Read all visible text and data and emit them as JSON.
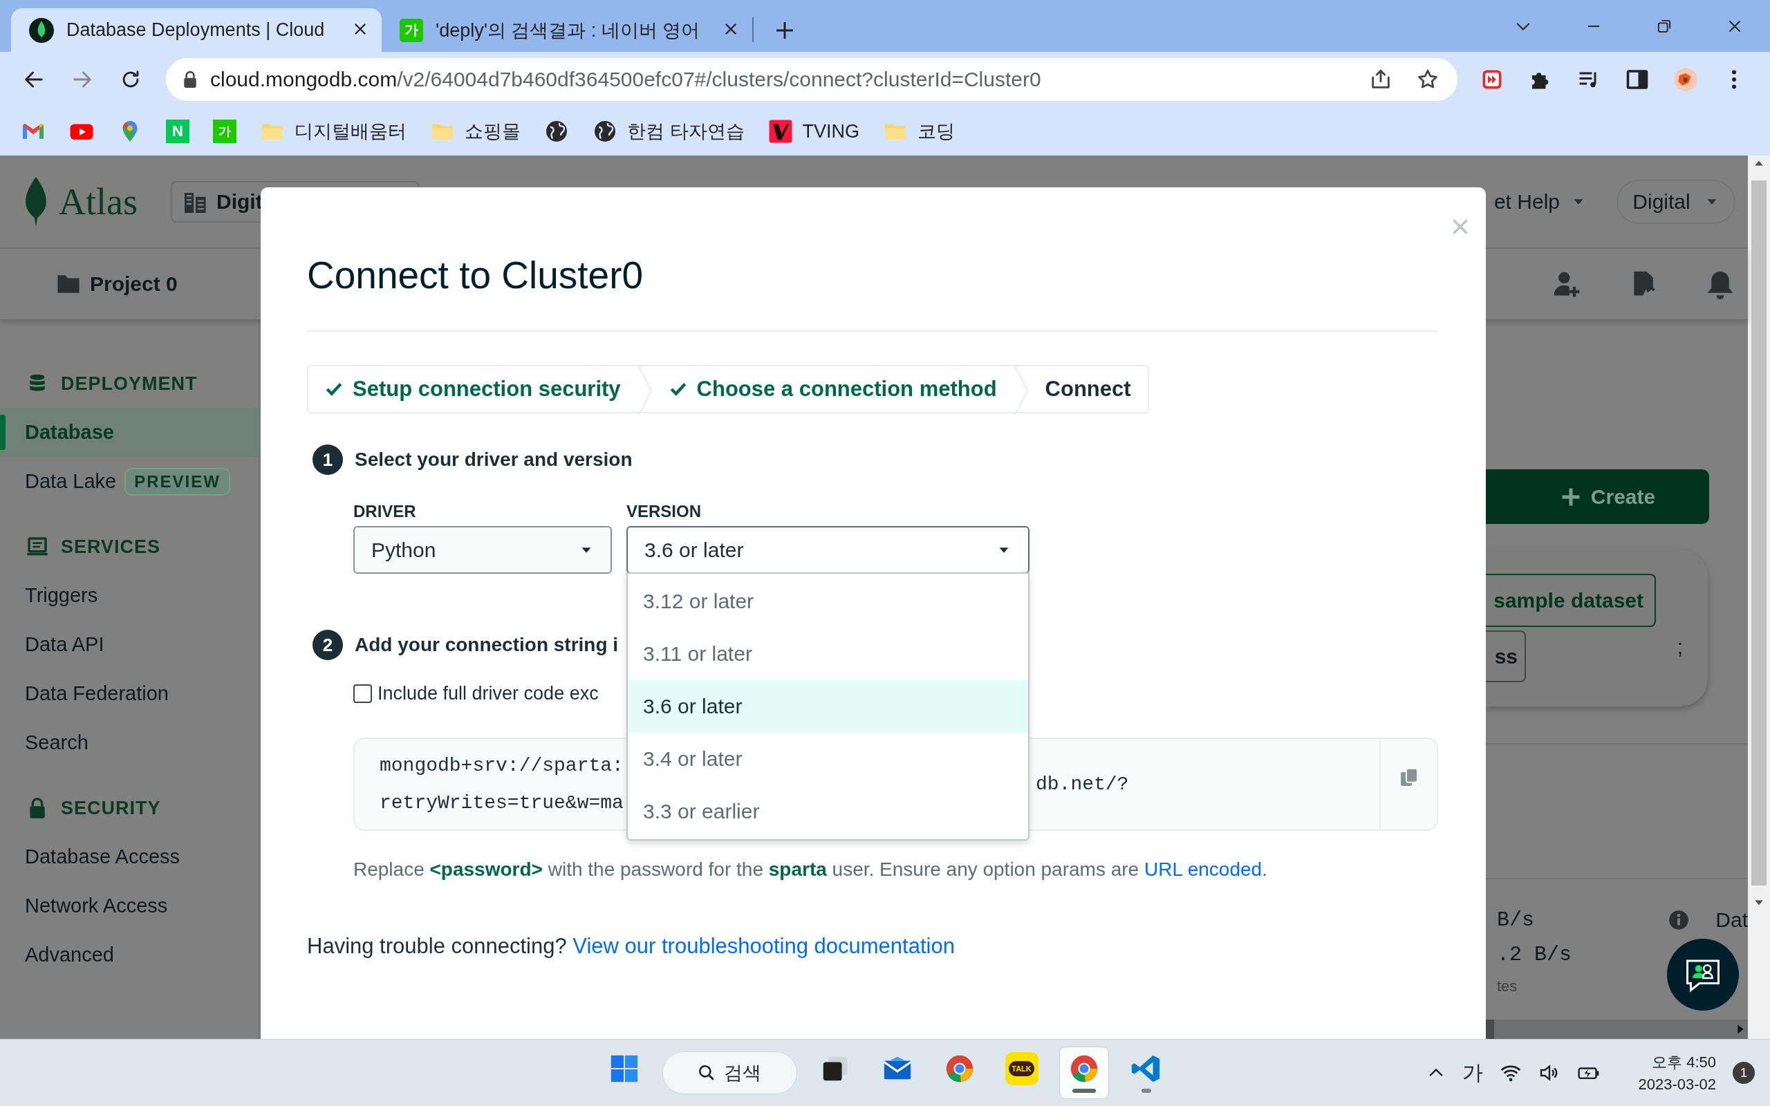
{
  "browser": {
    "tabs": [
      {
        "title": "Database Deployments | Cloud",
        "selected": true
      },
      {
        "title": "'deply'의 검색결과 : 네이버 영어",
        "selected": false,
        "glyph": "가"
      }
    ],
    "url_host": "cloud.mongodb.com",
    "url_path": "/v2/64004d7b460df364500efc07#/clusters/connect?clusterId=Cluster0",
    "bookmarks": [
      {
        "kind": "mail"
      },
      {
        "kind": "video"
      },
      {
        "kind": "pin"
      },
      {
        "kind": "tile",
        "glyph": "N"
      },
      {
        "kind": "tile",
        "glyph": "가"
      },
      {
        "kind": "folder",
        "label": "디지털배움터"
      },
      {
        "kind": "folder",
        "label": "쇼핑몰"
      },
      {
        "kind": "globe"
      },
      {
        "kind": "globe",
        "label": "한컴 타자연습"
      },
      {
        "kind": "brand",
        "label": "TVING"
      },
      {
        "kind": "folder",
        "label": "코딩"
      }
    ]
  },
  "atlas": {
    "logo": "Atlas",
    "org": "Digit",
    "help": "et Help",
    "org_menu": "Digital",
    "project": "Project 0",
    "sidebar": [
      {
        "kind": "section",
        "label": "DEPLOYMENT"
      },
      {
        "kind": "item",
        "label": "Database",
        "selected": true
      },
      {
        "kind": "item",
        "label": "Data Lake",
        "badge": "PREVIEW",
        "selected": false
      },
      {
        "kind": "section",
        "label": "SERVICES"
      },
      {
        "kind": "item",
        "label": "Triggers",
        "selected": false
      },
      {
        "kind": "item",
        "label": "Data API",
        "selected": false
      },
      {
        "kind": "item",
        "label": "Data Federation",
        "selected": false
      },
      {
        "kind": "item",
        "label": "Search",
        "selected": false
      },
      {
        "kind": "section",
        "label": "SECURITY"
      },
      {
        "kind": "item",
        "label": "Database Access",
        "selected": false
      },
      {
        "kind": "item",
        "label": "Network Access",
        "selected": false
      },
      {
        "kind": "item",
        "label": "Advanced",
        "selected": false
      }
    ],
    "create": "Create",
    "sample_button": "sample dataset",
    "dismiss_button": "ss",
    "card_text": ";",
    "metrics": [
      "B/s",
      ".2 B/s",
      "tes"
    ],
    "column_heading": "Dat"
  },
  "modal": {
    "title": "Connect to Cluster0",
    "steps": [
      {
        "label": "Setup connection security",
        "done": true
      },
      {
        "label": "Choose a connection method",
        "done": true
      },
      {
        "label": "Connect",
        "done": false
      }
    ],
    "section_1": {
      "number": "1",
      "heading": "Select your driver and version"
    },
    "driver": {
      "label": "DRIVER",
      "value": "Python"
    },
    "version": {
      "label": "VERSION",
      "value": "3.6 or later",
      "expanded": true,
      "options": [
        {
          "label": "3.12 or later",
          "selected": false
        },
        {
          "label": "3.11 or later",
          "selected": false
        },
        {
          "label": "3.6 or later",
          "selected": true
        },
        {
          "label": "3.4 or later",
          "selected": false
        },
        {
          "label": "3.3 or earlier",
          "selected": false
        }
      ]
    },
    "section_2": {
      "number": "2",
      "heading": "Add your connection string i"
    },
    "include_code": {
      "label": "Include full driver code exc",
      "checked": false
    },
    "code_left": [
      "mongodb+srv://sparta:",
      "retryWrites=true&w=ma"
    ],
    "code_right": [
      "db.net/?"
    ],
    "note": "Replace **<password>** with the password for the **sparta** user. Ensure any option params are ",
    "note_link": "URL encoded",
    "note_end": ".",
    "trouble": "Having trouble connecting?",
    "trouble_link": "View our troubleshooting documentation"
  },
  "taskbar": {
    "apps": [
      {
        "kind": "start",
        "selected": false,
        "running": false
      },
      {
        "kind": "search",
        "label": "검색"
      },
      {
        "kind": "taskview",
        "selected": false,
        "running": false
      },
      {
        "kind": "mail",
        "selected": false,
        "running": false
      },
      {
        "kind": "browser",
        "selected": false,
        "running": false
      },
      {
        "kind": "chat",
        "label": "TALK",
        "selected": false,
        "running": false
      },
      {
        "kind": "browser",
        "selected": true,
        "running": true
      },
      {
        "kind": "editor",
        "selected": false,
        "running": true
      }
    ],
    "tray": {
      "ime": "가",
      "time": "오후 4:50",
      "date": "2023-03-02",
      "badge": "1"
    }
  }
}
